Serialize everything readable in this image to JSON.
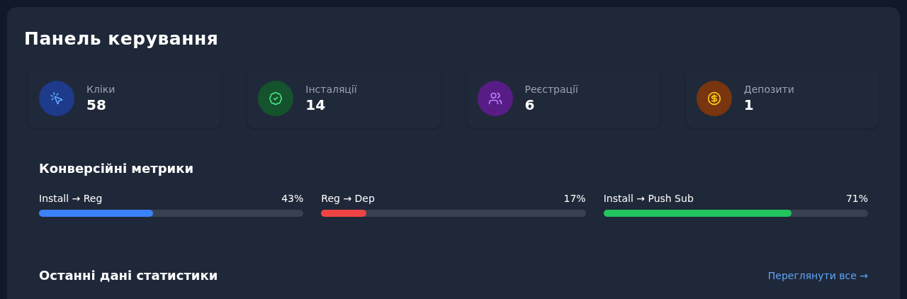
{
  "title": "Панель керування",
  "stats": [
    {
      "label": "Кліки",
      "value": "58",
      "color": "#1e3a8a"
    },
    {
      "label": "Інсталяції",
      "value": "14",
      "color": "#14532d"
    },
    {
      "label": "Реєстрації",
      "value": "6",
      "color": "#581c87"
    },
    {
      "label": "Депозити",
      "value": "1",
      "color": "#78350f"
    }
  ],
  "conversion": {
    "title": "Конверсійні метрики",
    "metrics": [
      {
        "label": "Install → Reg",
        "reading": "43%",
        "level": 0.43,
        "color": "#3b82f6"
      },
      {
        "label": "Reg → Dep",
        "reading": "17%",
        "level": 0.17,
        "color": "#ef4444"
      },
      {
        "label": "Install → Push Sub",
        "reading": "71%",
        "level": 0.71,
        "color": "#22c55e"
      }
    ]
  },
  "recent": {
    "title": "Останні дані статистики",
    "link": "Переглянути все →"
  }
}
